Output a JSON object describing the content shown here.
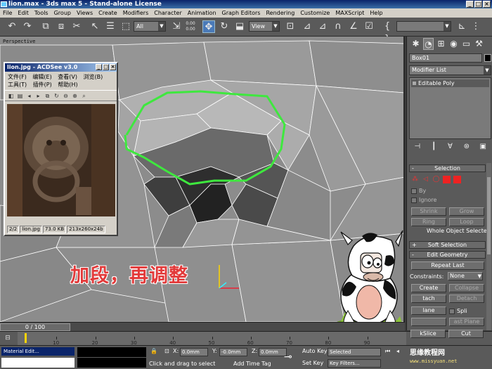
{
  "window": {
    "title": "lion.max - 3ds max 5 - Stand-alone License"
  },
  "menu": [
    "File",
    "Edit",
    "Tools",
    "Group",
    "Views",
    "Create",
    "Modifiers",
    "Character",
    "Animation",
    "Graph Editors",
    "Rendering",
    "Customize",
    "MAXScript",
    "Help"
  ],
  "toolbar": {
    "selection_filter": "All",
    "coord_system": "View",
    "spinner_value": "0.00\n0.00"
  },
  "viewport": {
    "label": "Perspective"
  },
  "acdsee": {
    "title": "lion.jpg - ACDSee v3.0",
    "menu_row1": [
      "文件(F)",
      "编辑(E)",
      "查看(V)",
      "浏览(B)"
    ],
    "menu_row2": [
      "工具(T)",
      "插件(P)",
      "帮助(H)"
    ],
    "status": {
      "index": "2/2",
      "file": "lion.jpg",
      "size": "73.0 KB",
      "dims": "213x260x24b"
    }
  },
  "caption": "加段，再调整",
  "command_panel": {
    "object_name": "Box01",
    "modifier_list": "Modifier List",
    "stack_item": "Editable Poly",
    "selection_rollout": "Selection",
    "by_label": "By",
    "ignore_label": "Ignore",
    "shrink": "Shrink",
    "grow": "Grow",
    "ring": "Ring",
    "loop": "Loop",
    "whole_object": "Whole Object Selected",
    "soft_selection": "Soft Selection",
    "edit_geometry": "Edit Geometry",
    "repeat_last": "Repeat Last",
    "constraints_label": "Constraints:",
    "constraints_value": "None",
    "create": "Create",
    "collapse": "Collapse",
    "attach": "tach",
    "detach": "Detach",
    "plane": "lane",
    "split": "Spli",
    "fast_plane": "ast Plane",
    "quickslice": "kSlice",
    "cut": "Cut"
  },
  "timeline": {
    "frame": "0 / 100",
    "ticks": [
      "10",
      "20",
      "30",
      "40",
      "50",
      "60",
      "70",
      "80",
      "90"
    ]
  },
  "statusbar": {
    "left_item": "Material Edit...",
    "prompt": "Click and drag to select",
    "add_time_tag": "Add Time Tag",
    "x_label": "X:",
    "x_value": "0.0mm",
    "y_label": "Y:",
    "y_value": "-0.0mm",
    "z_label": "Z:",
    "z_value": "0.0mm",
    "auto_key": "Auto Key",
    "set_key": "Set Key",
    "selected": "Selected",
    "key_filters": "Key Filters..."
  },
  "watermark": {
    "site_cn": "思缘教程网",
    "site_url": "www.missyuan.net"
  },
  "colors": {
    "edge_loop": "#3ee83e",
    "caption": "#e23a3a",
    "selection_accent": "#e22222"
  }
}
